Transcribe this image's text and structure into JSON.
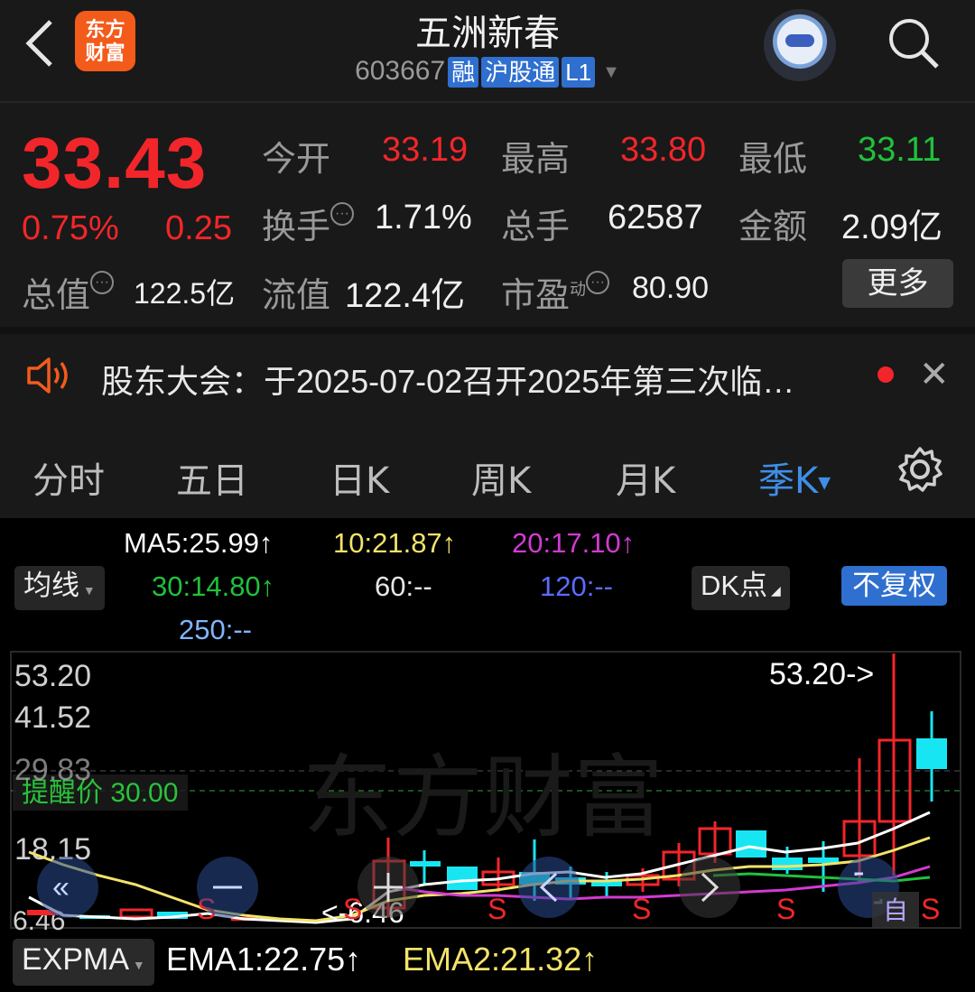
{
  "header": {
    "back_glyph": "‹",
    "logo_line1": "东方",
    "logo_line2": "财富",
    "title": "五洲新春",
    "code": "603667",
    "tags": [
      "融",
      "沪股通",
      "L1"
    ]
  },
  "quote": {
    "price": "33.43",
    "pct": "0.75%",
    "change": "0.25",
    "open_label": "今开",
    "open": "33.19",
    "high_label": "最高",
    "high": "33.80",
    "low_label": "最低",
    "low": "33.11",
    "turnover_label": "换手",
    "turnover": "1.71%",
    "volume_label": "总手",
    "volume": "62587",
    "amount_label": "金额",
    "amount": "2.09亿",
    "mktcap_label": "总值",
    "mktcap": "122.5亿",
    "float_label": "流值",
    "float": "122.4亿",
    "pe_label": "市盈",
    "pe_sup": "动",
    "pe": "80.90",
    "more_label": "更多"
  },
  "notice": {
    "text": "股东大会：于2025-07-02召开2025年第三次临…",
    "close_glyph": "✕"
  },
  "tabs": [
    "分时",
    "五日",
    "日K",
    "周K",
    "月K",
    "季K"
  ],
  "active_tab": "季K",
  "indicators": {
    "ma5": "MA5:25.99↑",
    "ma10": "10:21.87↑",
    "ma20": "20:17.10↑",
    "ma30": "30:14.80↑",
    "ma60": "60:--",
    "ma120": "120:--",
    "ma250": "250:--",
    "ma_button": "均线",
    "dk_button": "DK点",
    "fq_button": "不复权"
  },
  "chart": {
    "y_labels": [
      "53.20",
      "41.52",
      "29.83",
      "18.15",
      "6.46"
    ],
    "max_marker": "53.20->",
    "min_marker": "<-6.46",
    "alert_label": "提醒价 30.00",
    "watermark": "东方财富",
    "signal_s": "S",
    "signal_b": "自"
  },
  "sub_indicator": {
    "button": "EXPMA",
    "ema1": "EMA1:22.75↑",
    "ema2": "EMA2:21.32↑"
  },
  "colors": {
    "up": "#f2262a",
    "down": "#1fc23c",
    "accent": "#3f8ee8",
    "ma5": "#ffffff",
    "ma10": "#f2e36a",
    "ma20": "#d23bd2",
    "ma30": "#1fc23c",
    "ma120": "#5b6cff",
    "ma250": "#7fb6ff",
    "candle_down": "#17e6f2"
  }
}
